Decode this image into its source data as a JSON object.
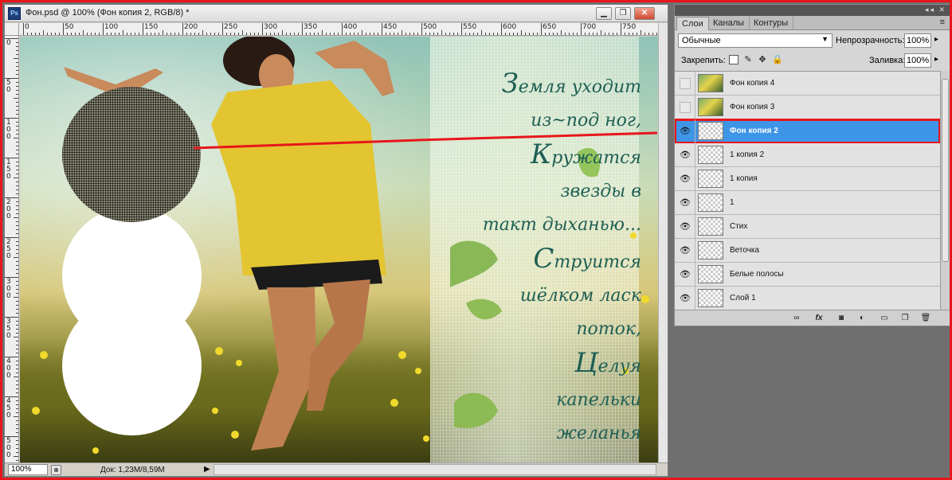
{
  "document": {
    "title": "Фон.psd @ 100% (Фон копия 2, RGB/8) *",
    "app_icon": "Ps",
    "ruler_h_labels": [
      "0",
      "50",
      "100",
      "150",
      "200",
      "250",
      "300",
      "350",
      "400",
      "450",
      "500",
      "550",
      "600",
      "650",
      "700",
      "750"
    ],
    "ruler_v_labels": [
      "0",
      "5 0",
      "1 0 0",
      "1 5 0",
      "2 0 0",
      "2 5 0",
      "3 0 0",
      "3 5 0",
      "4 0 0",
      "4 5 0",
      "5 0 0"
    ]
  },
  "poem": {
    "lines": [
      "Земля уходит",
      "из~под ног,",
      "Кружатся",
      "звезды в",
      "такт дыханью...",
      "Струится",
      "шёлком ласк",
      "поток,",
      "Целуя",
      "капельки",
      "желанья"
    ]
  },
  "status": {
    "zoom": "100%",
    "doc_size": "Док: 1,23M/8,59M",
    "arrow": "▶"
  },
  "panel": {
    "tabs": [
      "Слои",
      "Каналы",
      "Контуры"
    ],
    "menu_icon": "≡",
    "blend_mode": "Обычные",
    "opacity_label": "Непрозрачность:",
    "opacity_value": "100%",
    "lock_label": "Закрепить:",
    "fill_label": "Заливка:",
    "fill_value": "100%",
    "layers": [
      {
        "name": "Фон копия 4",
        "visible": false,
        "thumb": "photo",
        "selected": false
      },
      {
        "name": "Фон копия 3",
        "visible": false,
        "thumb": "photo",
        "selected": false
      },
      {
        "name": "Фон копия 2",
        "visible": true,
        "thumb": "transparent",
        "selected": true
      },
      {
        "name": "1 копия 2",
        "visible": true,
        "thumb": "transparent",
        "selected": false
      },
      {
        "name": "1 копия",
        "visible": true,
        "thumb": "transparent",
        "selected": false
      },
      {
        "name": "1",
        "visible": true,
        "thumb": "transparent",
        "selected": false
      },
      {
        "name": "Стих",
        "visible": true,
        "thumb": "transparent",
        "selected": false
      },
      {
        "name": "Веточка",
        "visible": true,
        "thumb": "transparent",
        "selected": false
      },
      {
        "name": "Белые полосы",
        "visible": true,
        "thumb": "transparent",
        "selected": false
      },
      {
        "name": "Слой 1",
        "visible": true,
        "thumb": "transparent",
        "selected": false
      }
    ],
    "footer_icons": [
      "link-icon",
      "fx-icon",
      "mask-icon",
      "adjustment-icon",
      "group-icon",
      "new-layer-icon",
      "trash-icon"
    ]
  },
  "colors": {
    "highlight_red": "#e8161b",
    "selection_blue": "#3e95e8",
    "poem_text": "#1e5f54"
  }
}
